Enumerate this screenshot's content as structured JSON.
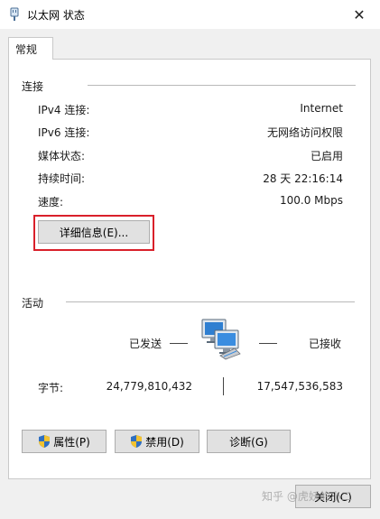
{
  "window": {
    "title": "以太网 状态"
  },
  "tabs": [
    {
      "label": "常规"
    }
  ],
  "connection": {
    "heading": "连接",
    "rows": [
      {
        "label": "IPv4 连接:",
        "value": "Internet"
      },
      {
        "label": "IPv6 连接:",
        "value": "无网络访问权限"
      },
      {
        "label": "媒体状态:",
        "value": "已启用"
      },
      {
        "label": "持续时间:",
        "value": "28 天 22:16:14"
      },
      {
        "label": "速度:",
        "value": "100.0 Mbps"
      }
    ],
    "details_button": "详细信息(E)..."
  },
  "activity": {
    "heading": "活动",
    "sent_label": "已发送",
    "received_label": "已接收",
    "bytes_label": "字节:",
    "bytes_sent": "24,779,810,432",
    "bytes_received": "17,547,536,583"
  },
  "buttons": {
    "properties": "属性(P)",
    "disable": "禁用(D)",
    "diagnose": "诊断(G)",
    "close": "关闭(C)"
  },
  "watermark": "知乎 @虎妖的小二",
  "colors": {
    "highlight": "#d9202a",
    "window_bg": "#f0f0f0"
  }
}
